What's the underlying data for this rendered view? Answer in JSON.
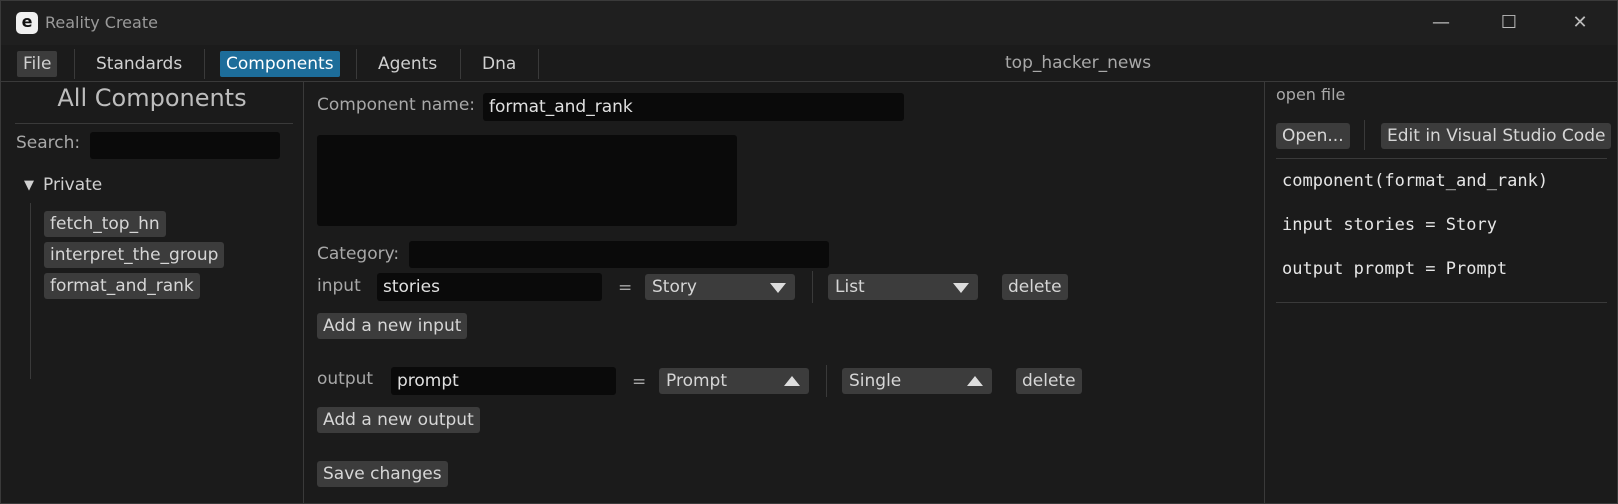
{
  "window": {
    "app_title": "Reality Create",
    "logo_letter": "e",
    "minimize_glyph": "—",
    "maximize_glyph": "☐",
    "close_glyph": "✕"
  },
  "menu": {
    "items": [
      "File",
      "Standards",
      "Components",
      "Agents",
      "Dna"
    ],
    "active": "Components",
    "project_name": "top_hacker_news"
  },
  "sidebar": {
    "title": "All Components",
    "search_label": "Search:",
    "search_value": "",
    "group_toggle": "▼",
    "group_label": "Private",
    "items": [
      "fetch_top_hn",
      "interpret_the_group",
      "format_and_rank"
    ]
  },
  "editor": {
    "name_label": "Component name:",
    "name_value": "format_and_rank",
    "description_value": "",
    "category_label": "Category:",
    "category_value": "",
    "input": {
      "label": "input",
      "name": "stories",
      "equals": "=",
      "type": "Story",
      "multiplicity": "List",
      "delete_label": "delete",
      "add_label": "Add a new input"
    },
    "output": {
      "label": "output",
      "name": "prompt",
      "equals": "=",
      "type": "Prompt",
      "multiplicity": "Single",
      "delete_label": "delete",
      "add_label": "Add a new output"
    },
    "save_label": "Save changes"
  },
  "file_panel": {
    "title": "open file",
    "open_label": "Open...",
    "vscode_label": "Edit in Visual Studio Code",
    "code_lines": [
      "component(format_and_rank)",
      "input stories = Story",
      "output prompt = Prompt"
    ]
  },
  "colors": {
    "accent": "#1d6d9a",
    "background": "#1b1b1b",
    "input_bg": "#0a0a0a",
    "button_bg": "#3c3c3c"
  }
}
